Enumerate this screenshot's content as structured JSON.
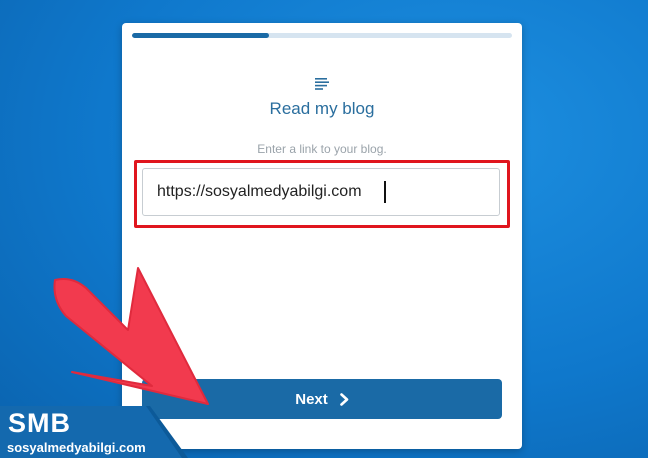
{
  "progress": {
    "fraction": 0.36
  },
  "card": {
    "icon": "text-lines-icon",
    "title": "Read my blog",
    "hint": "Enter a link to your blog.",
    "url_value": "https://sosyalmedyabilgi.com",
    "next_label": "Next",
    "next_icon": "chevron-right-icon"
  },
  "watermark": {
    "logo_text": "SMB",
    "site": "sosyalmedyabilgi.com"
  },
  "colors": {
    "accent": "#1a6aa6",
    "highlight": "#e0151e",
    "arrow": "#f23a4e",
    "background": "#0f78cc"
  }
}
